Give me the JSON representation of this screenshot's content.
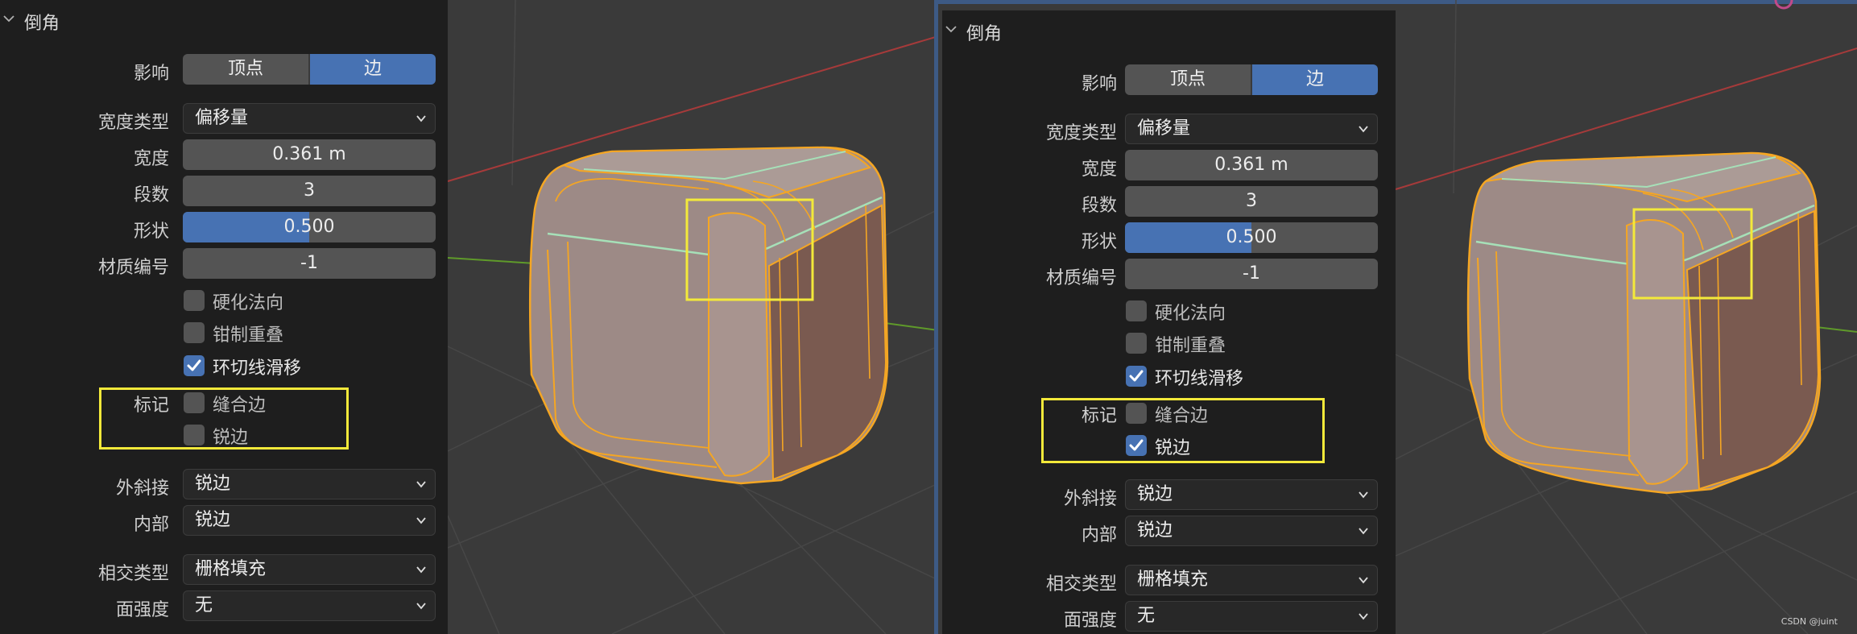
{
  "left": {
    "panel": {
      "title": "倒角",
      "affect": {
        "label": "影响",
        "options": [
          "顶点",
          "边"
        ],
        "selected": "边"
      },
      "width_type": {
        "label": "宽度类型",
        "value": "偏移量"
      },
      "width": {
        "label": "宽度",
        "value": "0.361 m"
      },
      "segments": {
        "label": "段数",
        "value": "3"
      },
      "shape": {
        "label": "形状",
        "value": "0.500",
        "level": 0.5
      },
      "material_index": {
        "label": "材质编号",
        "value": "-1"
      },
      "harden_normals": {
        "label": "硬化法向",
        "checked": false
      },
      "clamp_overlap": {
        "label": "钳制重叠",
        "checked": false
      },
      "loop_slide": {
        "label": "环切线滑移",
        "checked": true
      },
      "mark": {
        "label": "标记",
        "seam": {
          "label": "缝合边",
          "checked": false
        },
        "sharp": {
          "label": "锐边",
          "checked": false
        }
      },
      "miter_outer": {
        "label": "外斜接",
        "value": "锐边"
      },
      "miter_inner": {
        "label": "内部",
        "value": "锐边"
      },
      "intersection_type": {
        "label": "相交类型",
        "value": "栅格填充"
      },
      "face_strength": {
        "label": "面强度",
        "value": "无"
      }
    }
  },
  "right": {
    "panel": {
      "title": "倒角",
      "affect": {
        "label": "影响",
        "options": [
          "顶点",
          "边"
        ],
        "selected": "边"
      },
      "width_type": {
        "label": "宽度类型",
        "value": "偏移量"
      },
      "width": {
        "label": "宽度",
        "value": "0.361 m"
      },
      "segments": {
        "label": "段数",
        "value": "3"
      },
      "shape": {
        "label": "形状",
        "value": "0.500",
        "level": 0.5
      },
      "material_index": {
        "label": "材质编号",
        "value": "-1"
      },
      "harden_normals": {
        "label": "硬化法向",
        "checked": false
      },
      "clamp_overlap": {
        "label": "钳制重叠",
        "checked": false
      },
      "loop_slide": {
        "label": "环切线滑移",
        "checked": true
      },
      "mark": {
        "label": "标记",
        "seam": {
          "label": "缝合边",
          "checked": false
        },
        "sharp": {
          "label": "锐边",
          "checked": true
        }
      },
      "miter_outer": {
        "label": "外斜接",
        "value": "锐边"
      },
      "miter_inner": {
        "label": "内部",
        "value": "锐边"
      },
      "intersection_type": {
        "label": "相交类型",
        "value": "栅格填充"
      },
      "face_strength": {
        "label": "面强度",
        "value": "无"
      }
    }
  },
  "watermark": "CSDN @juint",
  "colors": {
    "accent": "#4772b3",
    "highlight_box": "#f3e93a",
    "mesh_select": "#f5a623",
    "axis_x": "#c0392b",
    "axis_y": "#6aa52a"
  }
}
